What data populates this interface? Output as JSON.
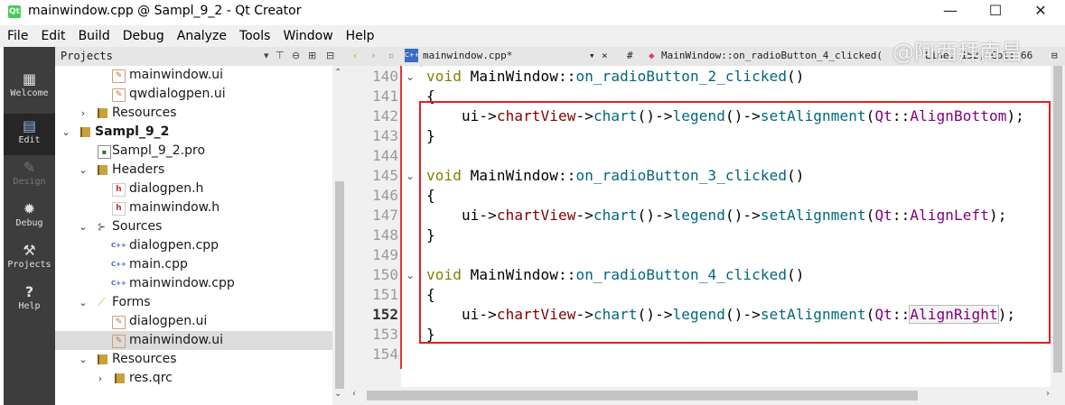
{
  "window": {
    "app_icon": "qt",
    "title": "mainwindow.cpp @ Sampl_9_2 - Qt Creator",
    "minimize": "—",
    "maximize": "☐",
    "close": "✕"
  },
  "menubar": [
    "File",
    "Edit",
    "Build",
    "Debug",
    "Analyze",
    "Tools",
    "Window",
    "Help"
  ],
  "modes": [
    {
      "label": "Welcome",
      "icon": "grid-icon",
      "glyph": "▦"
    },
    {
      "label": "Edit",
      "icon": "edit-document-icon",
      "glyph": "▤"
    },
    {
      "label": "Design",
      "icon": "pencil-icon",
      "glyph": "✎"
    },
    {
      "label": "Debug",
      "icon": "bug-icon",
      "glyph": "✹"
    },
    {
      "label": "Projects",
      "icon": "wrench-icon",
      "glyph": "⚒"
    },
    {
      "label": "Help",
      "icon": "help-icon",
      "glyph": "?"
    }
  ],
  "projects": {
    "header": "Projects",
    "tree": [
      {
        "label": "mainwindow.ui",
        "type": "ui"
      },
      {
        "label": "qwdialogpen.ui",
        "type": "ui"
      },
      {
        "label": "Resources",
        "type": "folder",
        "expander": "›"
      },
      {
        "label": "Sampl_9_2",
        "type": "folder",
        "expander": "⌄",
        "bold": true
      },
      {
        "label": "Sampl_9_2.pro",
        "type": "pro"
      },
      {
        "label": "Headers",
        "type": "headers",
        "expander": "⌄"
      },
      {
        "label": "dialogpen.h",
        "type": "h"
      },
      {
        "label": "mainwindow.h",
        "type": "h"
      },
      {
        "label": "Sources",
        "type": "sources",
        "expander": "⌄"
      },
      {
        "label": "dialogpen.cpp",
        "type": "cpp"
      },
      {
        "label": "main.cpp",
        "type": "cpp"
      },
      {
        "label": "mainwindow.cpp",
        "type": "cpp"
      },
      {
        "label": "Forms",
        "type": "forms",
        "expander": "⌄"
      },
      {
        "label": "dialogpen.ui",
        "type": "ui"
      },
      {
        "label": "mainwindow.ui",
        "type": "ui",
        "selected": true
      },
      {
        "label": "Resources",
        "type": "folder",
        "expander": "⌄"
      },
      {
        "label": "res.qrc",
        "type": "folder",
        "expander": "›"
      }
    ]
  },
  "editor": {
    "file_tab": "mainwindow.cpp*",
    "hash": "#",
    "symbol": "MainWindow::on_radioButton_4_clicked(",
    "position": "Line: 152, Col: 66",
    "lines": [
      {
        "n": "140",
        "fold": true,
        "code": "void MainWindow::on_radioButton_2_clicked()"
      },
      {
        "n": "141",
        "code": "{"
      },
      {
        "n": "142",
        "code": "    ui->chartView->chart()->legend()->setAlignment(Qt::AlignBottom);"
      },
      {
        "n": "143",
        "code": "}"
      },
      {
        "n": "144",
        "code": ""
      },
      {
        "n": "145",
        "fold": true,
        "code": "void MainWindow::on_radioButton_3_clicked()"
      },
      {
        "n": "146",
        "code": "{"
      },
      {
        "n": "147",
        "code": "    ui->chartView->chart()->legend()->setAlignment(Qt::AlignLeft);"
      },
      {
        "n": "148",
        "code": "}"
      },
      {
        "n": "149",
        "code": ""
      },
      {
        "n": "150",
        "fold": true,
        "code": "void MainWindow::on_radioButton_4_clicked()"
      },
      {
        "n": "151",
        "code": "{"
      },
      {
        "n": "152",
        "code": "    ui->chartView->chart()->legend()->setAlignment(Qt::AlignRight);",
        "current": true
      },
      {
        "n": "153",
        "code": "}"
      },
      {
        "n": "154",
        "code": ""
      }
    ]
  },
  "watermark": "@阿西拜南昌",
  "colors": {
    "keyword": "#808000",
    "function": "#00677c",
    "member": "#800000",
    "enum": "#800080",
    "highlight_box": "#e02020"
  }
}
